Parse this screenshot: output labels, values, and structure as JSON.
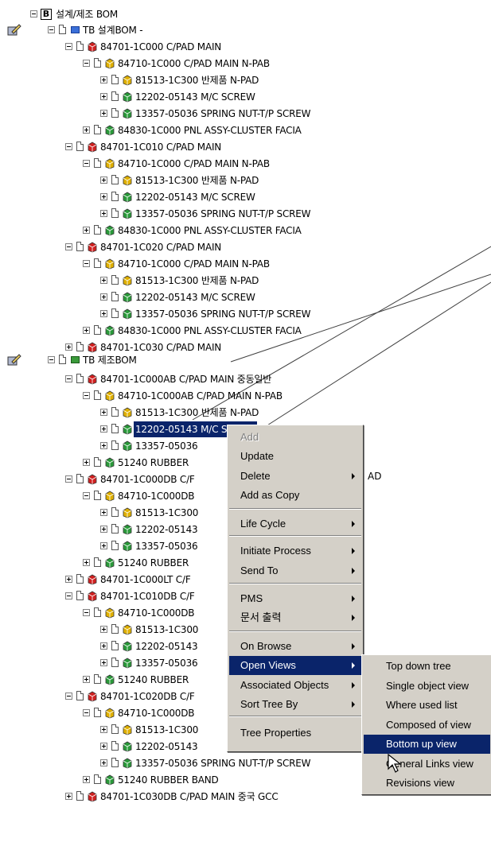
{
  "tree_root": {
    "label": "설계/제조 BOM"
  },
  "sections": [
    {
      "label": "TB 설계BOM -",
      "badge_color": "#3a6fd8"
    },
    {
      "label": "TB 제조BOM",
      "badge_color": "#3a9a3a"
    }
  ],
  "tree_items": [
    {
      "label": "84701-1C000  C/PAD MAIN",
      "icon": "red-part-icon"
    },
    {
      "label": "84710-1C000  C/PAD MAIN N-PAB",
      "icon": "yellow-part-icon"
    },
    {
      "label": "81513-1C300  반제품 N-PAD",
      "icon": "yellow-part-icon"
    },
    {
      "label": "12202-05143  M/C SCREW",
      "icon": "green-part-icon"
    },
    {
      "label": "13357-05036  SPRING NUT-T/P SCREW",
      "icon": "green-part-icon"
    },
    {
      "label": "84830-1C000  PNL ASSY-CLUSTER FACIA",
      "icon": "green-part-icon"
    },
    {
      "label": "84701-1C010  C/PAD MAIN",
      "icon": "red-part-icon"
    },
    {
      "label": "84710-1C000  C/PAD MAIN N-PAB",
      "icon": "yellow-part-icon"
    },
    {
      "label": "81513-1C300  반제품 N-PAD",
      "icon": "yellow-part-icon"
    },
    {
      "label": "12202-05143  M/C SCREW",
      "icon": "green-part-icon"
    },
    {
      "label": "13357-05036  SPRING NUT-T/P SCREW",
      "icon": "green-part-icon"
    },
    {
      "label": "84830-1C000  PNL ASSY-CLUSTER FACIA",
      "icon": "green-part-icon"
    },
    {
      "label": "84701-1C020  C/PAD MAIN",
      "icon": "red-part-icon"
    },
    {
      "label": "84710-1C000  C/PAD MAIN N-PAB",
      "icon": "yellow-part-icon"
    },
    {
      "label": "81513-1C300  반제품 N-PAD",
      "icon": "yellow-part-icon"
    },
    {
      "label": "12202-05143  M/C SCREW",
      "icon": "green-part-icon"
    },
    {
      "label": "13357-05036  SPRING NUT-T/P SCREW",
      "icon": "green-part-icon"
    },
    {
      "label": "84830-1C000  PNL ASSY-CLUSTER FACIA",
      "icon": "green-part-icon"
    },
    {
      "label": "84701-1C030  C/PAD MAIN",
      "icon": "red-part-icon"
    },
    {
      "label": "84701-1C000AB  C/PAD MAIN 중동일반",
      "icon": "red-part-icon"
    },
    {
      "label": "84710-1C000AB  C/PAD MAIN N-PAB",
      "icon": "yellow-part-icon"
    },
    {
      "label": "81513-1C300  반제품 N-PAD",
      "icon": "yellow-part-icon"
    },
    {
      "label": "12202-05143  M/C SCREW",
      "icon": "green-part-icon"
    },
    {
      "label": "13357-05036",
      "icon": "green-part-icon"
    },
    {
      "label": "51240  RUBBER",
      "icon": "green-part-icon"
    },
    {
      "label": "84701-1C000DB  C/F",
      "icon": "red-part-icon"
    },
    {
      "label": "84710-1C000DB",
      "icon": "yellow-part-icon"
    },
    {
      "label": "81513-1C300",
      "icon": "yellow-part-icon"
    },
    {
      "label": "12202-05143",
      "icon": "green-part-icon"
    },
    {
      "label": "13357-05036",
      "icon": "green-part-icon"
    },
    {
      "label": "51240  RUBBER",
      "icon": "green-part-icon"
    },
    {
      "label": "84701-1C000LT  C/F",
      "icon": "red-part-icon"
    },
    {
      "label": "84701-1C010DB  C/F",
      "icon": "red-part-icon"
    },
    {
      "label": "84710-1C000DB",
      "icon": "yellow-part-icon"
    },
    {
      "label": "81513-1C300",
      "icon": "yellow-part-icon"
    },
    {
      "label": "12202-05143",
      "icon": "green-part-icon"
    },
    {
      "label": "13357-05036",
      "icon": "green-part-icon"
    },
    {
      "label": "51240  RUBBER",
      "icon": "green-part-icon"
    },
    {
      "label": "84701-1C020DB  C/F",
      "icon": "red-part-icon"
    },
    {
      "label": "84710-1C000DB",
      "icon": "yellow-part-icon"
    },
    {
      "label": "81513-1C300",
      "icon": "yellow-part-icon"
    },
    {
      "label": "12202-05143",
      "icon": "green-part-icon"
    },
    {
      "label": "13357-05036  SPRING NUT-T/P SCREW",
      "icon": "green-part-icon"
    },
    {
      "label": "51240  RUBBER BAND",
      "icon": "green-part-icon"
    },
    {
      "label": "84701-1C030DB  C/PAD MAIN 중국 GCC",
      "icon": "red-part-icon"
    }
  ],
  "overflow_text": "AD",
  "context_menu": {
    "items": [
      {
        "label": "Add",
        "disabled": true
      },
      {
        "label": "Update"
      },
      {
        "label": "Delete",
        "submenu": true
      },
      {
        "label": "Add as Copy"
      },
      {
        "label": "Life Cycle",
        "submenu": true
      },
      {
        "label": "Initiate Process",
        "submenu": true
      },
      {
        "label": "Send To",
        "submenu": true
      },
      {
        "label": "PMS",
        "submenu": true
      },
      {
        "label": "문서 출력",
        "submenu": true
      },
      {
        "label": "On Browse",
        "submenu": true
      },
      {
        "label": "Open Views",
        "submenu": true,
        "highlighted": true
      },
      {
        "label": "Associated Objects",
        "submenu": true
      },
      {
        "label": "Sort Tree By",
        "submenu": true
      },
      {
        "label": "Tree Properties"
      }
    ]
  },
  "submenu": {
    "items": [
      {
        "label": "Top down tree"
      },
      {
        "label": "Single object view"
      },
      {
        "label": "Where used list"
      },
      {
        "label": "Composed of view"
      },
      {
        "label": "Bottom up view",
        "highlighted": true
      },
      {
        "label": "General Links view"
      },
      {
        "label": "Revisions view"
      }
    ]
  },
  "colors": {
    "selection": "#0a246a",
    "menu_bg": "#d4d0c8"
  }
}
